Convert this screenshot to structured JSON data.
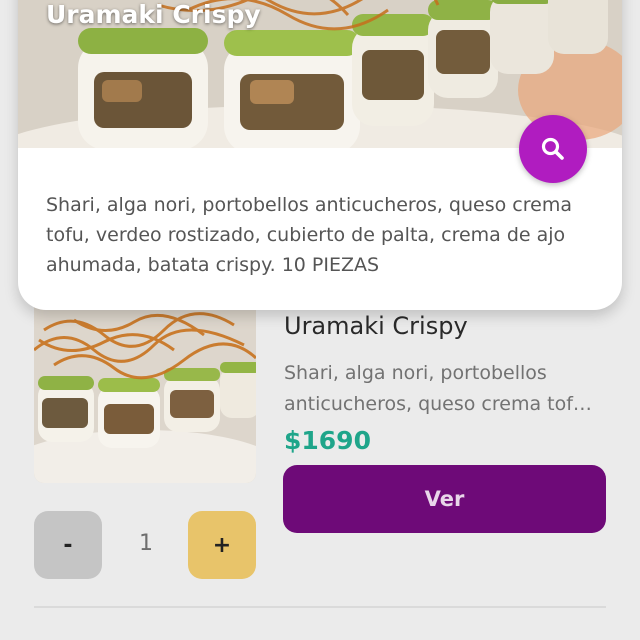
{
  "popup": {
    "title": "Uramaki Crispy",
    "description_lines": [
      "Shari, alga nori, portobellos anticucheros, queso crema",
      "tofu, verdeo rostizado, cubierto de palta, crema de ajo",
      "ahumada, batata crispy. 10 PIEZAS"
    ],
    "search_icon": "search-icon",
    "search_button_color": "#b01cc0"
  },
  "product": {
    "name": "Uramaki Crispy",
    "description_line_1": "Shari, alga nori, portobellos",
    "description_line_2": "anticucheros, queso crema tof…",
    "price": "$1690",
    "price_color": "#1fa58a",
    "view_label": "Ver",
    "view_button_color": "#6e0a78",
    "quantity": {
      "minus_label": "-",
      "value": "1",
      "plus_label": "+",
      "minus_color": "#c5c5c5",
      "plus_color": "#e8c46a"
    }
  }
}
